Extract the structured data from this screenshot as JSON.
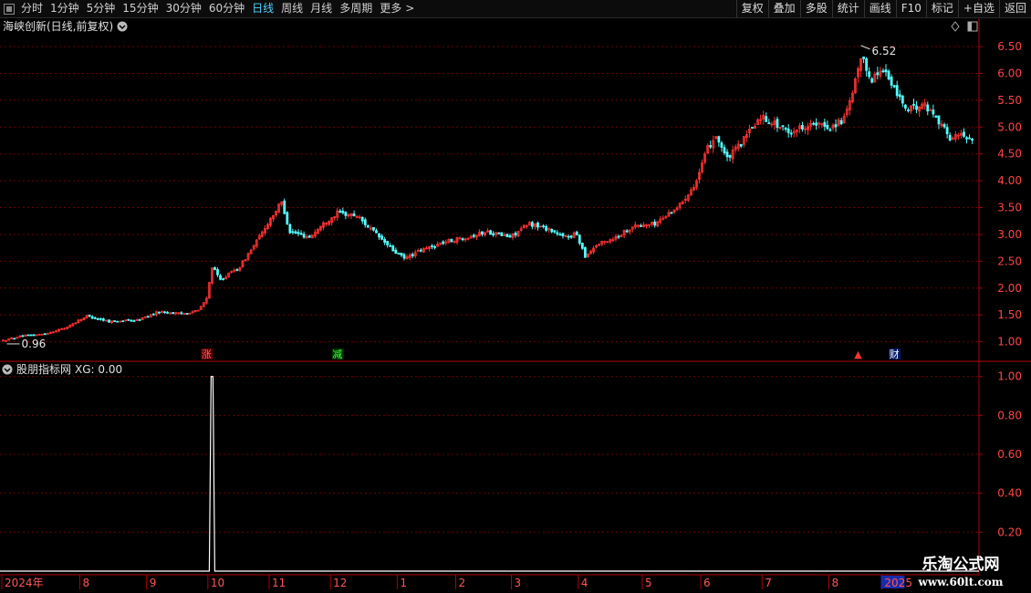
{
  "toolbar": {
    "periods": [
      {
        "label": "分时",
        "active": false
      },
      {
        "label": "1分钟",
        "active": false
      },
      {
        "label": "5分钟",
        "active": false
      },
      {
        "label": "15分钟",
        "active": false
      },
      {
        "label": "30分钟",
        "active": false
      },
      {
        "label": "60分钟",
        "active": false
      },
      {
        "label": "日线",
        "active": true
      },
      {
        "label": "周线",
        "active": false
      },
      {
        "label": "月线",
        "active": false
      },
      {
        "label": "多周期",
        "active": false
      },
      {
        "label": "更多",
        "active": false
      }
    ],
    "more_arrow": ">",
    "buttons": [
      "复权",
      "叠加",
      "多股",
      "统计",
      "画线",
      "F10",
      "标记",
      "+自选",
      "返回"
    ]
  },
  "main_title": "海峡创新(日线,前复权)",
  "indicator_title": "股朋指标网",
  "indicator_label": "XG: 0.00",
  "colors": {
    "up": "#ff3232",
    "down": "#54ffff",
    "grid": "#6e0000",
    "axis_line": "#b00000",
    "indicator_line": "#ffffff",
    "active_tab": "#4fd2ff"
  },
  "chart_data": [
    {
      "type": "candlestick",
      "y_ticks": [
        1.0,
        1.5,
        2.0,
        2.5,
        3.0,
        3.5,
        4.0,
        4.5,
        5.0,
        5.5,
        6.0,
        6.5
      ],
      "ylim": [
        0.84,
        6.62
      ],
      "high_label": "6.52",
      "low_label": "0.96",
      "anchors": [
        [
          0,
          1.02
        ],
        [
          6,
          1.1
        ],
        [
          14,
          1.14
        ],
        [
          22,
          1.25
        ],
        [
          30,
          1.48
        ],
        [
          38,
          1.38
        ],
        [
          48,
          1.4
        ],
        [
          56,
          1.56
        ],
        [
          64,
          1.52
        ],
        [
          70,
          1.58
        ],
        [
          73,
          1.8
        ],
        [
          75,
          2.4
        ],
        [
          78,
          2.15
        ],
        [
          85,
          2.4
        ],
        [
          92,
          2.95
        ],
        [
          96,
          3.3
        ],
        [
          100,
          3.6
        ],
        [
          103,
          3.05
        ],
        [
          110,
          2.95
        ],
        [
          115,
          3.2
        ],
        [
          120,
          3.4
        ],
        [
          127,
          3.35
        ],
        [
          133,
          3.05
        ],
        [
          140,
          2.7
        ],
        [
          144,
          2.55
        ],
        [
          150,
          2.7
        ],
        [
          158,
          2.85
        ],
        [
          166,
          2.95
        ],
        [
          174,
          3.05
        ],
        [
          182,
          2.95
        ],
        [
          189,
          3.2
        ],
        [
          196,
          3.1
        ],
        [
          201,
          2.95
        ],
        [
          206,
          3.0
        ],
        [
          209,
          2.6
        ],
        [
          213,
          2.8
        ],
        [
          220,
          2.95
        ],
        [
          226,
          3.15
        ],
        [
          234,
          3.2
        ],
        [
          238,
          3.35
        ],
        [
          243,
          3.55
        ],
        [
          249,
          4.0
        ],
        [
          253,
          4.6
        ],
        [
          256,
          4.85
        ],
        [
          260,
          4.4
        ],
        [
          265,
          4.7
        ],
        [
          272,
          5.2
        ],
        [
          276,
          5.1
        ],
        [
          282,
          4.9
        ],
        [
          289,
          5.05
        ],
        [
          297,
          5.0
        ],
        [
          302,
          5.15
        ],
        [
          305,
          5.6
        ],
        [
          308,
          6.3
        ],
        [
          312,
          5.9
        ],
        [
          316,
          6.1
        ],
        [
          320,
          5.7
        ],
        [
          325,
          5.3
        ],
        [
          330,
          5.45
        ],
        [
          335,
          5.2
        ],
        [
          340,
          4.8
        ],
        [
          344,
          4.85
        ],
        [
          348,
          4.8
        ]
      ],
      "events": [
        {
          "label": "涨",
          "bar": 73
        },
        {
          "label": "减",
          "bar": 120
        },
        {
          "label": "▲",
          "bar": 307
        },
        {
          "label": "财",
          "bar": 320
        }
      ]
    },
    {
      "type": "line",
      "series": [
        {
          "name": "XG",
          "spike_bar": 75,
          "base": 0.0,
          "peak": 1.0
        }
      ],
      "y_ticks": [
        0.2,
        0.4,
        0.6,
        0.8,
        1.0
      ],
      "ylim": [
        0,
        1.05
      ],
      "x_ticks": [
        "2024年",
        "8",
        "9",
        "10",
        "11",
        "12",
        "1",
        "2",
        "3",
        "4",
        "5",
        "6",
        "7",
        "8",
        "2025"
      ],
      "x_tick_bars": [
        0,
        28,
        52,
        74,
        96,
        118,
        142,
        163,
        183,
        207,
        230,
        251,
        273,
        297,
        316
      ]
    }
  ],
  "watermark": {
    "line1": "乐淘公式网",
    "line2": "www.60lt.com"
  }
}
